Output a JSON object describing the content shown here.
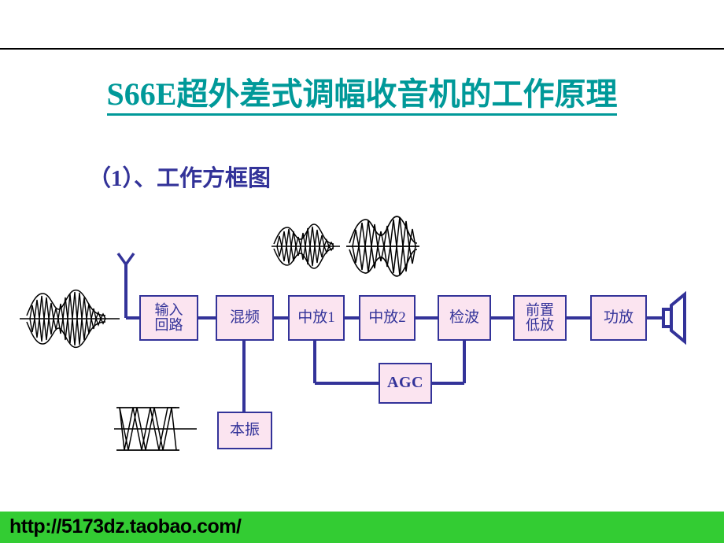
{
  "slide": {
    "title_latin": "S66E",
    "title_cjk": "超外差式调幅收音机的工作原理",
    "title_color": "#009999",
    "subtitle": "（1）、工作方框图",
    "subtitle_color": "#333399"
  },
  "diagram": {
    "block_fill": "#fbe4f0",
    "block_stroke": "#333399",
    "wire_color": "#333399",
    "waveform_color": "#000000",
    "blocks": [
      {
        "id": "input-circuit",
        "label": "输入\n回路",
        "line1": "输入",
        "line2": "回路"
      },
      {
        "id": "mixer",
        "label": "混频",
        "line1": "混频",
        "line2": ""
      },
      {
        "id": "if-amp-1",
        "label": "中放1",
        "line1": "中放1",
        "line2": ""
      },
      {
        "id": "if-amp-2",
        "label": "中放2",
        "line1": "中放2",
        "line2": ""
      },
      {
        "id": "detector",
        "label": "检波",
        "line1": "检波",
        "line2": ""
      },
      {
        "id": "preamp",
        "label": "前置\n低放",
        "line1": "前置",
        "line2": "低放"
      },
      {
        "id": "power-amp",
        "label": "功放",
        "line1": "功放",
        "line2": ""
      },
      {
        "id": "agc",
        "label": "AGC",
        "line1": "AGC",
        "line2": ""
      },
      {
        "id": "local-oscillator",
        "label": "本振",
        "line1": "本振",
        "line2": ""
      }
    ],
    "symbols": {
      "antenna": "antenna-icon",
      "speaker": "speaker-icon",
      "waveform_rf_input": "am-waveform-small",
      "waveform_if_1": "am-waveform-medium",
      "waveform_if_2": "am-waveform-large",
      "waveform_oscillator": "oscillator-waveform"
    }
  },
  "footer": {
    "url": "http://5173dz.taobao.com/",
    "bar_color": "#33cc33",
    "text_color": "#000000"
  }
}
